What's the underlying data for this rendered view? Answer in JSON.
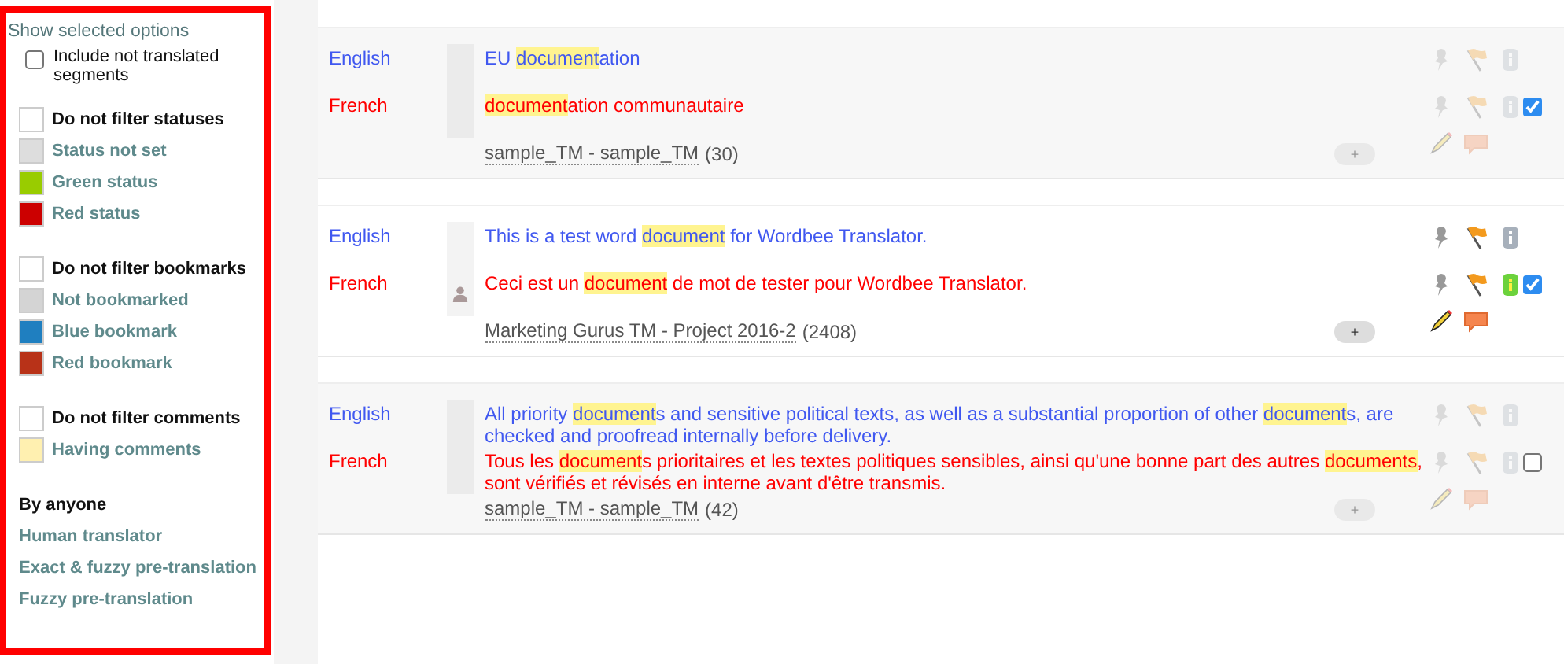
{
  "filter_panel": {
    "title": "Show selected options",
    "include_untranslated": {
      "label": "Include not translated segments",
      "checked": false
    },
    "groups": [
      {
        "items": [
          {
            "kind": "header",
            "label": "Do not filter statuses",
            "color": "#ffffff"
          },
          {
            "kind": "option",
            "label": "Status not set",
            "color": "#dddddd"
          },
          {
            "kind": "option",
            "label": "Green status",
            "color": "#99cc00"
          },
          {
            "kind": "option",
            "label": "Red status",
            "color": "#cc0000"
          }
        ]
      },
      {
        "items": [
          {
            "kind": "header",
            "label": "Do not filter bookmarks",
            "color": "#ffffff"
          },
          {
            "kind": "option",
            "label": "Not bookmarked",
            "color": "#d4d4d4"
          },
          {
            "kind": "option",
            "label": "Blue bookmark",
            "color": "#1f7fc0"
          },
          {
            "kind": "option",
            "label": "Red bookmark",
            "color": "#b83218"
          }
        ]
      },
      {
        "items": [
          {
            "kind": "header",
            "label": "Do not filter comments",
            "color": "#ffffff"
          },
          {
            "kind": "option",
            "label": "Having comments",
            "color": "#fff0b0"
          }
        ]
      },
      {
        "items": [
          {
            "kind": "title",
            "label": "By anyone"
          },
          {
            "kind": "link",
            "label": "Human translator"
          },
          {
            "kind": "link",
            "label": "Exact & fuzzy pre-translation"
          },
          {
            "kind": "link",
            "label": "Fuzzy pre-translation"
          }
        ]
      }
    ]
  },
  "segments": [
    {
      "active": false,
      "selected": true,
      "rows": [
        {
          "lang": "English",
          "kind": "source",
          "avatar": false,
          "status_green": false,
          "parts": [
            {
              "text": "EU ",
              "hl": false
            },
            {
              "text": "document",
              "hl": true
            },
            {
              "text": "ation",
              "hl": false
            }
          ]
        },
        {
          "lang": "French",
          "kind": "target",
          "avatar": false,
          "status_green": false,
          "parts": [
            {
              "text": "document",
              "hl": true
            },
            {
              "text": "ation communautaire",
              "hl": false
            }
          ]
        }
      ],
      "tm": "sample_TM - sample_TM",
      "count": "(30)",
      "add": "+"
    },
    {
      "active": true,
      "selected": true,
      "rows": [
        {
          "lang": "English",
          "kind": "source",
          "avatar": false,
          "status_green": false,
          "parts": [
            {
              "text": "This is a test word ",
              "hl": false
            },
            {
              "text": "document",
              "hl": true
            },
            {
              "text": " for Wordbee Translator.",
              "hl": false
            }
          ]
        },
        {
          "lang": "French",
          "kind": "target",
          "avatar": true,
          "status_green": true,
          "parts": [
            {
              "text": "Ceci est un ",
              "hl": false
            },
            {
              "text": "document",
              "hl": true
            },
            {
              "text": " de mot de tester pour Wordbee Translator.",
              "hl": false
            }
          ]
        }
      ],
      "tm": "Marketing Gurus TM - Project 2016-2",
      "count": "(2408)",
      "add": "+"
    },
    {
      "active": false,
      "selected": false,
      "rows": [
        {
          "lang": "English",
          "kind": "source",
          "avatar": false,
          "status_green": false,
          "parts": [
            {
              "text": "All priority ",
              "hl": false
            },
            {
              "text": "document",
              "hl": true
            },
            {
              "text": "s and sensitive political texts, as well as a substantial proportion of other ",
              "hl": false
            },
            {
              "text": "document",
              "hl": true
            },
            {
              "text": "s, are checked and proofread internally before delivery.",
              "hl": false
            }
          ]
        },
        {
          "lang": "French",
          "kind": "target",
          "avatar": false,
          "status_green": false,
          "parts": [
            {
              "text": "Tous les ",
              "hl": false
            },
            {
              "text": "document",
              "hl": true
            },
            {
              "text": "s prioritaires et les textes politiques sensibles, ainsi qu'une bonne part des autres ",
              "hl": false
            },
            {
              "text": "documents",
              "hl": true
            },
            {
              "text": ", sont vérifiés et révisés en interne avant d'être transmis.",
              "hl": false
            }
          ]
        }
      ],
      "tm": "sample_TM - sample_TM",
      "count": "(42)",
      "add": "+"
    }
  ]
}
